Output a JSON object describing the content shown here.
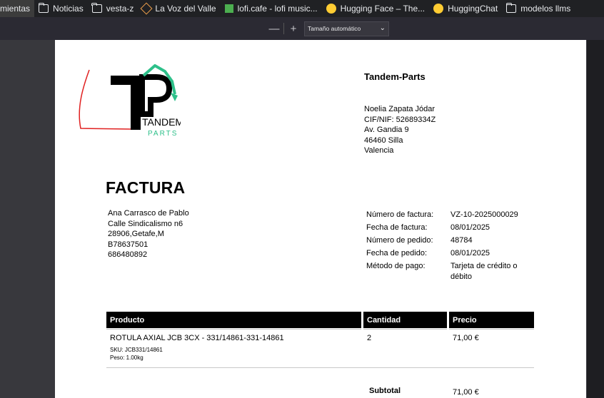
{
  "bookmarks": [
    {
      "label": "mientas",
      "icon": "none"
    },
    {
      "label": "Noticias",
      "icon": "folder-icon"
    },
    {
      "label": "vesta-z",
      "icon": "folder-icon"
    },
    {
      "label": "La Voz del Valle",
      "icon": "cube-icon"
    },
    {
      "label": "lofi.cafe - lofi music...",
      "icon": "lofi-icon"
    },
    {
      "label": "Hugging Face – The...",
      "icon": "hugging-face-icon"
    },
    {
      "label": "HuggingChat",
      "icon": "hugging-chat-icon"
    },
    {
      "label": "modelos llms",
      "icon": "folder-icon"
    }
  ],
  "pdf_toolbar": {
    "zoom_out": "—",
    "zoom_in": "+",
    "zoom_value": "Tamaño automático",
    "chevron": "⌄"
  },
  "invoice": {
    "logo_text_1": "TANDEM",
    "logo_text_2": "PARTS",
    "company_name": "Tandem-Parts",
    "seller_lines": [
      "Noelia Zapata Jódar",
      "CIF/NIF: 52689334Z",
      "Av. Gandia 9",
      "46460 Silla",
      "Valencia"
    ],
    "title": "FACTURA",
    "buyer_lines": [
      "Ana Carrasco de Pablo",
      "Calle Sindicalismo n6",
      "28906,Getafe,M",
      "B78637501",
      "686480892"
    ],
    "meta": [
      {
        "label": "Número de factura:",
        "value": "VZ-10-2025000029"
      },
      {
        "label": "Fecha de factura:",
        "value": "08/01/2025"
      },
      {
        "label": "Número de pedido:",
        "value": "48784"
      },
      {
        "label": "Fecha de pedido:",
        "value": "08/01/2025"
      },
      {
        "label": "Método de pago:",
        "value": "Tarjeta de crédito o débito"
      }
    ],
    "table": {
      "headers": [
        "Producto",
        "Cantidad",
        "Precio"
      ],
      "rows": [
        {
          "product": "ROTULA AXIAL JCB 3CX - 331/14861-331-14861",
          "sku": "SKU:  JCB331/14861",
          "weight": "Peso:  1.00kg",
          "qty": "2",
          "price": "71,00 €"
        }
      ]
    },
    "subtotal_label": "Subtotal",
    "subtotal_value": "71,00 €"
  },
  "colors": {
    "logo_accent": "#2ec08a",
    "annotation": "#e02020"
  }
}
